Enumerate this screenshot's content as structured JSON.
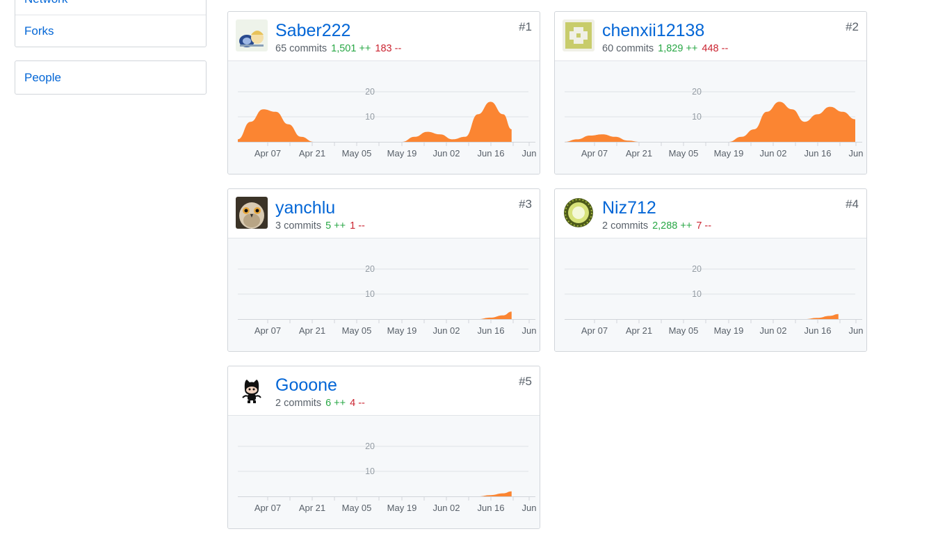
{
  "sidebar": {
    "items": [
      {
        "label": "Network"
      },
      {
        "label": "Forks"
      },
      {
        "label": "People"
      }
    ]
  },
  "colors": {
    "link": "#0366d6",
    "additions": "#28a745",
    "deletions": "#cb2431",
    "area": "#fb8532",
    "graph_bg": "#f6f8fa"
  },
  "contributors": [
    {
      "rank": "#1",
      "login": "Saber222",
      "commits": "65 commits",
      "additions": "1,501 ++",
      "deletions": "183 --",
      "avatar": "anime-figure-avatar"
    },
    {
      "rank": "#2",
      "login": "chenxii12138",
      "commits": "60 commits",
      "additions": "1,829 ++",
      "deletions": "448 --",
      "avatar": "identicon-avatar"
    },
    {
      "rank": "#3",
      "login": "yanchlu",
      "commits": "3 commits",
      "additions": "5 ++",
      "deletions": "1 --",
      "avatar": "owl-photo-avatar"
    },
    {
      "rank": "#4",
      "login": "Niz712",
      "commits": "2 commits",
      "additions": "2,288 ++",
      "deletions": "7 --",
      "avatar": "green-sphere-avatar"
    },
    {
      "rank": "#5",
      "login": "Gooone",
      "commits": "2 commits",
      "additions": "6 ++",
      "deletions": "4 --",
      "avatar": "octocat-avatar"
    }
  ],
  "chart_data": [
    {
      "type": "area",
      "title": "Saber222",
      "x_ticks": [
        "Apr 07",
        "Apr 21",
        "May 05",
        "May 19",
        "Jun 02",
        "Jun 16",
        "Jun"
      ],
      "y_ticks": [
        10,
        20
      ],
      "ylim": [
        0,
        22
      ],
      "points": [
        [
          0,
          1
        ],
        [
          6,
          8
        ],
        [
          12,
          13
        ],
        [
          18,
          12
        ],
        [
          24,
          7
        ],
        [
          30,
          2
        ],
        [
          36,
          0
        ],
        [
          42,
          0
        ],
        [
          48,
          0
        ],
        [
          54,
          0
        ],
        [
          60,
          0
        ],
        [
          66,
          0
        ],
        [
          72,
          0
        ],
        [
          78,
          0
        ],
        [
          84,
          2
        ],
        [
          90,
          4
        ],
        [
          96,
          3
        ],
        [
          102,
          1
        ],
        [
          108,
          2
        ],
        [
          114,
          11
        ],
        [
          120,
          16
        ],
        [
          126,
          11
        ],
        [
          130,
          5
        ]
      ]
    },
    {
      "type": "area",
      "title": "chenxii12138",
      "x_ticks": [
        "Apr 07",
        "Apr 21",
        "May 05",
        "May 19",
        "Jun 02",
        "Jun 16",
        "Jun"
      ],
      "y_ticks": [
        10,
        20
      ],
      "ylim": [
        0,
        22
      ],
      "points": [
        [
          0,
          0
        ],
        [
          6,
          1
        ],
        [
          12,
          2.5
        ],
        [
          18,
          3
        ],
        [
          24,
          2
        ],
        [
          30,
          0.5
        ],
        [
          36,
          0
        ],
        [
          42,
          0
        ],
        [
          48,
          0
        ],
        [
          54,
          0
        ],
        [
          60,
          0
        ],
        [
          66,
          0
        ],
        [
          72,
          0
        ],
        [
          78,
          0
        ],
        [
          84,
          2
        ],
        [
          90,
          5
        ],
        [
          96,
          12
        ],
        [
          102,
          16
        ],
        [
          108,
          13
        ],
        [
          114,
          8
        ],
        [
          120,
          11
        ],
        [
          126,
          14
        ],
        [
          132,
          12
        ],
        [
          138,
          9
        ]
      ]
    },
    {
      "type": "area",
      "title": "yanchlu",
      "x_ticks": [
        "Apr 07",
        "Apr 21",
        "May 05",
        "May 19",
        "Jun 02",
        "Jun 16",
        "Jun"
      ],
      "y_ticks": [
        10,
        20
      ],
      "ylim": [
        0,
        22
      ],
      "points": [
        [
          0,
          0
        ],
        [
          108,
          0
        ],
        [
          114,
          0
        ],
        [
          120,
          0.6
        ],
        [
          126,
          1.5
        ],
        [
          130,
          3
        ]
      ]
    },
    {
      "type": "area",
      "title": "Niz712",
      "x_ticks": [
        "Apr 07",
        "Apr 21",
        "May 05",
        "May 19",
        "Jun 02",
        "Jun 16",
        "Jun"
      ],
      "y_ticks": [
        10,
        20
      ],
      "ylim": [
        0,
        22
      ],
      "points": [
        [
          0,
          0
        ],
        [
          108,
          0
        ],
        [
          114,
          0
        ],
        [
          120,
          0.5
        ],
        [
          126,
          1.3
        ],
        [
          130,
          2
        ]
      ]
    },
    {
      "type": "area",
      "title": "Gooone",
      "x_ticks": [
        "Apr 07",
        "Apr 21",
        "May 05",
        "May 19",
        "Jun 02",
        "Jun 16",
        "Jun"
      ],
      "y_ticks": [
        10,
        20
      ],
      "ylim": [
        0,
        22
      ],
      "points": [
        [
          0,
          0
        ],
        [
          108,
          0
        ],
        [
          114,
          0
        ],
        [
          120,
          0.5
        ],
        [
          126,
          1.2
        ],
        [
          130,
          2
        ]
      ]
    }
  ]
}
